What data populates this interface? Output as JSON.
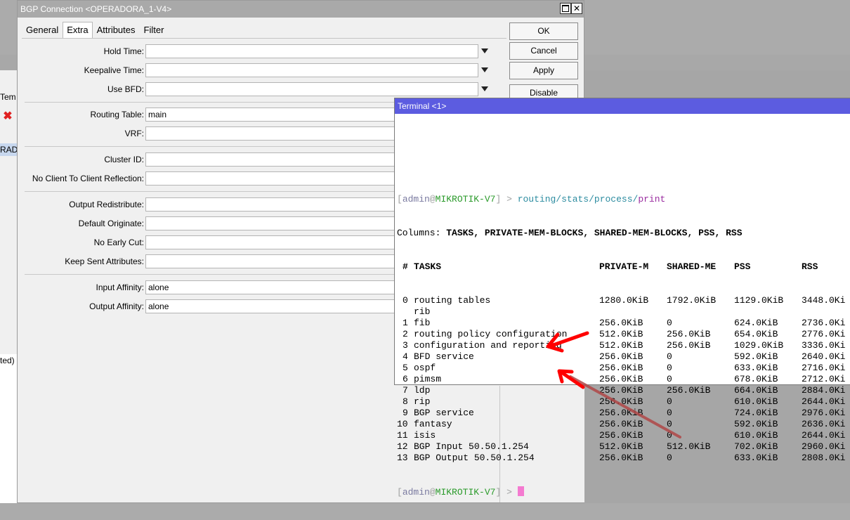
{
  "background_window": {
    "left_tab_text": "Tem",
    "left_row_text": "RADO",
    "left_status_text": "ted)"
  },
  "dialog": {
    "title": "BGP Connection <OPERADORA_1-V4>",
    "tabs": [
      {
        "label": "General",
        "active": false
      },
      {
        "label": "Extra",
        "active": true
      },
      {
        "label": "Attributes",
        "active": false
      },
      {
        "label": "Filter",
        "active": false
      }
    ],
    "buttons": {
      "ok": "OK",
      "cancel": "Cancel",
      "apply": "Apply",
      "disable": "Disable"
    },
    "fields": {
      "hold_time": {
        "label": "Hold Time:",
        "value": ""
      },
      "keepalive_time": {
        "label": "Keepalive Time:",
        "value": ""
      },
      "use_bfd": {
        "label": "Use BFD:",
        "value": ""
      },
      "routing_table": {
        "label": "Routing Table:",
        "value": "main"
      },
      "vrf": {
        "label": "VRF:",
        "value": ""
      },
      "cluster_id": {
        "label": "Cluster ID:",
        "value": ""
      },
      "no_client_reflection": {
        "label": "No Client To Client Reflection:",
        "value": ""
      },
      "output_redistribute": {
        "label": "Output Redistribute:",
        "value": ""
      },
      "default_originate": {
        "label": "Default Originate:",
        "value": ""
      },
      "no_early_cut": {
        "label": "No Early Cut:",
        "value": ""
      },
      "keep_sent_attributes": {
        "label": "Keep Sent Attributes:",
        "value": ""
      },
      "input_affinity": {
        "label": "Input Affinity:",
        "value": "alone"
      },
      "output_affinity": {
        "label": "Output Affinity:",
        "value": "alone"
      }
    }
  },
  "terminal": {
    "title": "Terminal <1>",
    "prompt": {
      "open": "[",
      "user": "admin",
      "at": "@",
      "host": "MIKROTIK-V7",
      "close": "] > "
    },
    "command_a": "routing/stats/",
    "command_b": "process/",
    "command_c": "print",
    "columns_label": "Columns:",
    "columns_value": " TASKS, PRIVATE-MEM-BLOCKS, SHARED-MEM-BLOCKS, PSS, RSS",
    "headers": [
      "#",
      "TASKS",
      "PRIVATE-M",
      "SHARED-ME",
      "PSS",
      "RSS"
    ],
    "rows": [
      {
        "num": "0",
        "task": "routing tables",
        "private": "1280.0KiB",
        "shared": "1792.0KiB",
        "pss": "1129.0KiB",
        "rss": "3448.0Ki"
      },
      {
        "num": "",
        "task": "rib",
        "private": "",
        "shared": "",
        "pss": "",
        "rss": ""
      },
      {
        "num": "1",
        "task": "fib",
        "private": "256.0KiB",
        "shared": "0",
        "pss": "624.0KiB",
        "rss": "2736.0Ki"
      },
      {
        "num": "2",
        "task": "routing policy configuration",
        "private": "512.0KiB",
        "shared": "256.0KiB",
        "pss": "654.0KiB",
        "rss": "2776.0Ki"
      },
      {
        "num": "3",
        "task": "configuration and reporting",
        "private": "512.0KiB",
        "shared": "256.0KiB",
        "pss": "1029.0KiB",
        "rss": "3336.0Ki"
      },
      {
        "num": "4",
        "task": "BFD service",
        "private": "256.0KiB",
        "shared": "0",
        "pss": "592.0KiB",
        "rss": "2640.0Ki"
      },
      {
        "num": "5",
        "task": "ospf",
        "private": "256.0KiB",
        "shared": "0",
        "pss": "633.0KiB",
        "rss": "2716.0Ki"
      },
      {
        "num": "6",
        "task": "pimsm",
        "private": "256.0KiB",
        "shared": "0",
        "pss": "678.0KiB",
        "rss": "2712.0Ki"
      },
      {
        "num": "7",
        "task": "ldp",
        "private": "256.0KiB",
        "shared": "256.0KiB",
        "pss": "664.0KiB",
        "rss": "2884.0Ki"
      },
      {
        "num": "8",
        "task": "rip",
        "private": "256.0KiB",
        "shared": "0",
        "pss": "610.0KiB",
        "rss": "2644.0Ki"
      },
      {
        "num": "9",
        "task": "BGP service",
        "private": "256.0KiB",
        "shared": "0",
        "pss": "724.0KiB",
        "rss": "2976.0Ki"
      },
      {
        "num": "10",
        "task": "fantasy",
        "private": "256.0KiB",
        "shared": "0",
        "pss": "592.0KiB",
        "rss": "2636.0Ki"
      },
      {
        "num": "11",
        "task": "isis",
        "private": "256.0KiB",
        "shared": "0",
        "pss": "610.0KiB",
        "rss": "2644.0Ki"
      },
      {
        "num": "12",
        "task": "BGP Input 50.50.1.254",
        "private": "512.0KiB",
        "shared": "512.0KiB",
        "pss": "702.0KiB",
        "rss": "2960.0Ki"
      },
      {
        "num": "13",
        "task": "BGP Output 50.50.1.254",
        "private": "256.0KiB",
        "shared": "0",
        "pss": "633.0KiB",
        "rss": "2808.0Ki"
      }
    ],
    "cursor_color": "#f47ad0"
  },
  "colors": {
    "terminal_title_bg": "#5c5ce0",
    "annotation_red": "#ff0000",
    "annotation_dark_arrow": "#b04848"
  }
}
